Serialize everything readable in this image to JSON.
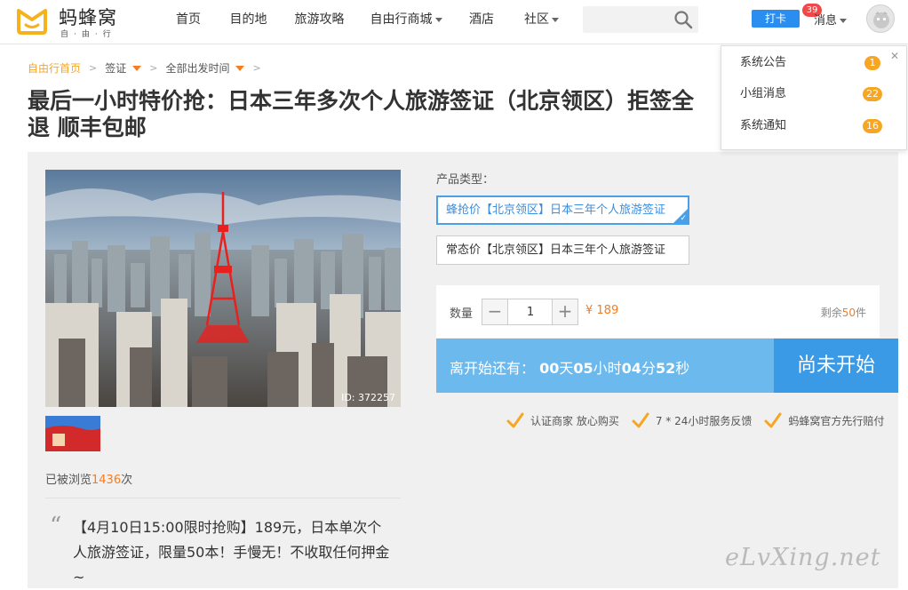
{
  "logo": {
    "name": "蚂蜂窝",
    "sub": "自·由·行"
  },
  "nav": [
    {
      "label": "首页",
      "dropdown": false
    },
    {
      "label": "目的地",
      "dropdown": false
    },
    {
      "label": "旅游攻略",
      "dropdown": false
    },
    {
      "label": "自由行商城",
      "dropdown": true
    },
    {
      "label": "酒店",
      "dropdown": false
    },
    {
      "label": "社区",
      "dropdown": true
    }
  ],
  "search": {
    "placeholder": ""
  },
  "header_right": {
    "punch_label": "打卡",
    "messages_label": "消息",
    "messages_badge": "39"
  },
  "notifications": [
    {
      "label": "系统公告",
      "count": "1"
    },
    {
      "label": "小组消息",
      "count": "22"
    },
    {
      "label": "系统通知",
      "count": "16"
    }
  ],
  "breadcrumb": {
    "home": "自由行首页",
    "visa": "签证",
    "departure": "全部出发时间"
  },
  "title": "最后一小时特价抢：日本三年多次个人旅游签证（北京领区）拒签全退 顺丰包邮",
  "gallery": {
    "image_id": "ID: 372257"
  },
  "views": {
    "prefix": "已被浏览",
    "count": "1436",
    "suffix": "次"
  },
  "promo": "【4月10日15:00限时抢购】189元，日本单次个人旅游签证，限量50本！手慢无！不收取任何押金~",
  "product": {
    "type_label": "产品类型：",
    "options": [
      {
        "label": "蜂抢价【北京领区】日本三年个人旅游签证",
        "selected": true
      },
      {
        "label": "常态价【北京领区】日本三年个人旅游签证",
        "selected": false
      }
    ]
  },
  "quantity": {
    "label": "数量",
    "minus": "−",
    "plus": "+",
    "value": "1",
    "price": "¥ 189",
    "stock_prefix": "剩余",
    "stock_num": "50",
    "stock_suffix": "件"
  },
  "countdown": {
    "prefix": "离开始还有：",
    "days": "00",
    "days_unit": "天",
    "hours": "05",
    "hours_unit": "小时",
    "minutes": "04",
    "minutes_unit": "分",
    "seconds": "52",
    "seconds_unit": "秒"
  },
  "status_button": "尚未开始",
  "guarantees": [
    "认证商家 放心购买",
    "7 * 24小时服务反馈",
    "蚂蜂窝官方先行赔付"
  ],
  "watermark": "eLvXing.net",
  "colors": {
    "accent_orange": "#f67c1e",
    "accent_blue": "#3b9ae6",
    "light_blue": "#6cb9ee",
    "badge_orange": "#f6a623"
  }
}
